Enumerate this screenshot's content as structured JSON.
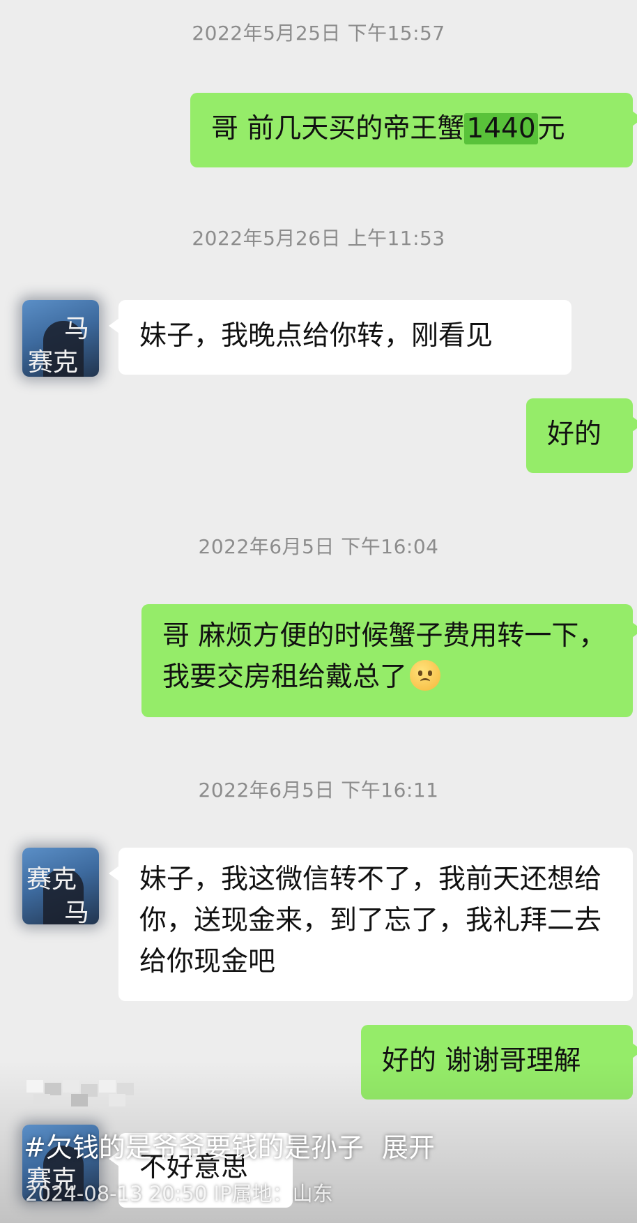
{
  "messages": {
    "t1": "2022年5月25日 下午15:57",
    "m1_pre": "哥 前几天买的帝王蟹",
    "m1_amount": "1440",
    "m1_post": "元",
    "t2": "2022年5月26日 上午11:53",
    "m2": "妹子，我晚点给你转，刚看见",
    "m3": "好的",
    "t3": "2022年6月5日 下午16:04",
    "m4": "哥 麻烦方便的时候蟹子费用转一下，我要交房租给戴总了",
    "t4": "2022年6月5日 下午16:11",
    "m5": "妹子，我这微信转不了，我前天还想给你，送现金来，到了忘了，我礼拜二去给你现金吧",
    "m6": "好的 谢谢哥理解",
    "m7": "不好意思"
  },
  "avatar": {
    "line1": "马",
    "line2": "赛克"
  },
  "emoji_icon": "sad-face-emoji",
  "overlay": {
    "hashtag": "#欠钱的是爷爷要钱的是孙子",
    "expand": "展开",
    "meta": "2024-08-13 20:50  IP属地：山东"
  },
  "colors": {
    "me": "#95ec69",
    "them": "#ffffff",
    "background": "#ededed"
  }
}
